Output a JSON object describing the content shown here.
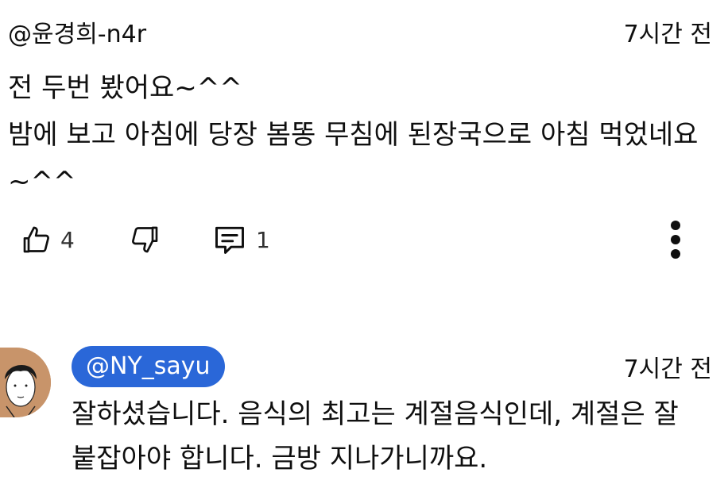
{
  "comment": {
    "author": "@윤경희-n4r",
    "time": "7시간 전",
    "body": "전 두번 봤어요~^^\n밤에 보고 아침에 당장 봄똥 무침에 된장국으로 아침 먹었네요~^^",
    "likes": "4",
    "replies": "1"
  },
  "reply": {
    "author": "@NY_sayu",
    "time": "7시간 전",
    "body": "잘하셨습니다. 음식의 최고는 계절음식인데, 계절은 잘 붙잡아야 합니다. 금방 지나가니까요."
  },
  "colors": {
    "author_chip": "#2a67d8",
    "avatar_bg": "#c8946a"
  },
  "icons": {
    "like": "thumbs-up-icon",
    "dislike": "thumbs-down-icon",
    "reply": "comment-icon",
    "more": "more-vert-icon"
  }
}
